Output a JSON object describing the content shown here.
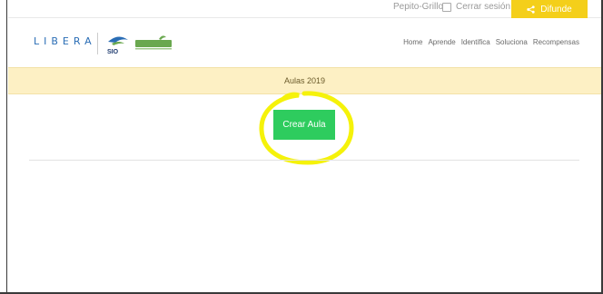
{
  "topbar": {
    "user_name": "Pepito-Grillo",
    "logout_label": "Cerrar sesión",
    "share_label": "Difunde"
  },
  "header": {
    "logo_text": "LIBERA",
    "logo_tagline": "",
    "partner_logo_text": "SIO",
    "nav": [
      "Home",
      "Aprende",
      "Identifica",
      "Soluciona",
      "Recompensas"
    ]
  },
  "title_band": {
    "title": "Aulas 2019"
  },
  "main": {
    "create_button_label": "Crear Aula"
  },
  "colors": {
    "brand_yellow": "#f4cf1a",
    "band_background": "#fdf0c4",
    "button_green": "#2ecc5e",
    "highlight_yellow": "#f5f20a",
    "logo_blue": "#2a6db5"
  }
}
